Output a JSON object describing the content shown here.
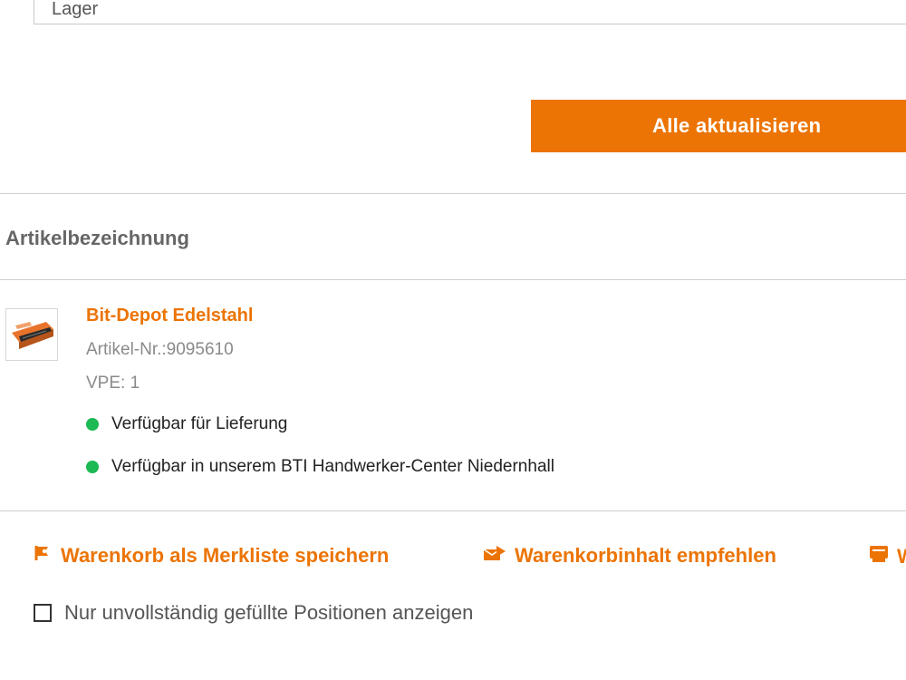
{
  "filter_field": {
    "value": "Lager"
  },
  "update_button": {
    "label": "Alle aktualisieren"
  },
  "table": {
    "column_header": "Artikelbezeichnung"
  },
  "product": {
    "name": "Bit-Depot Edelstahl",
    "article_number": "Artikel-Nr.:9095610",
    "vpe": "VPE: 1",
    "availability": [
      {
        "text": "Verfügbar für Lieferung",
        "status_color": "#1db954"
      },
      {
        "text": "Verfügbar in unserem BTI Handwerker-Center Niedernhall",
        "status_color": "#1db954"
      }
    ],
    "image_icon": "bit-depot-product-image"
  },
  "actions": {
    "save_wishlist": {
      "label": "Warenkorb als Merkliste speichern",
      "icon": "wishlist-icon"
    },
    "recommend": {
      "label": "Warenkorbinhalt empfehlen",
      "icon": "recommend-icon"
    },
    "third": {
      "label": "W",
      "icon": "cart-icon"
    }
  },
  "filter_checkbox": {
    "label": "Nur unvollständig gefüllte Positionen anzeigen",
    "checked": false
  },
  "colors": {
    "accent": "#ec7404",
    "available": "#1db954"
  }
}
